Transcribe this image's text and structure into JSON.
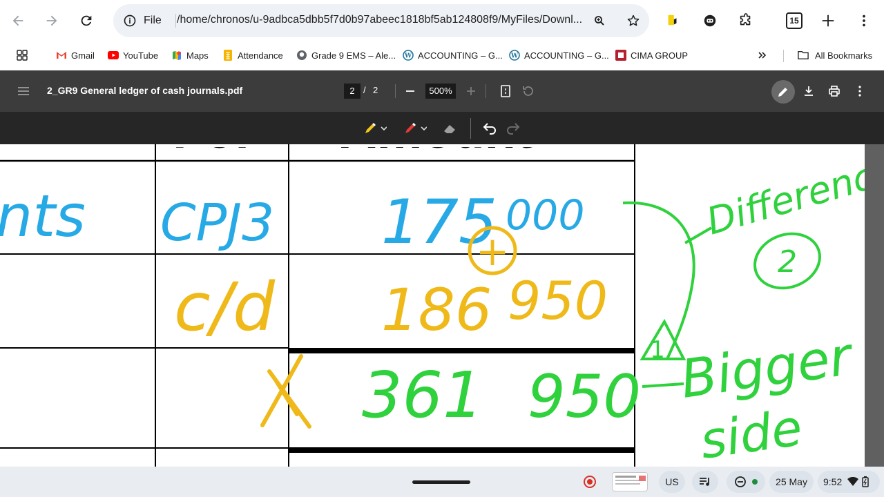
{
  "browser": {
    "site_label": "File",
    "url": "/home/chronos/u-9adbca5dbb5f7d0b97abeec1818bf5ab124808f9/MyFiles/Downl...",
    "tab_count": "15"
  },
  "bookmarks": [
    {
      "label": "Gmail",
      "icon": "gmail-icon"
    },
    {
      "label": "YouTube",
      "icon": "youtube-icon"
    },
    {
      "label": "Maps",
      "icon": "maps-icon"
    },
    {
      "label": "Attendance",
      "icon": "sheets-icon"
    },
    {
      "label": "Grade 9 EMS – Ale...",
      "icon": "github-icon"
    },
    {
      "label": "ACCOUNTING – G...",
      "icon": "wordpress-icon"
    },
    {
      "label": "ACCOUNTING – G...",
      "icon": "wordpress-icon"
    },
    {
      "label": "CIMA GROUP",
      "icon": "cima-icon"
    }
  ],
  "all_bookmarks": "All Bookmarks",
  "pdf": {
    "title": "2_GR9 General ledger of cash journals.pdf",
    "page_current": "2",
    "page_sep": "/",
    "page_total": "2",
    "zoom": "500%"
  },
  "document": {
    "header_fragments": [
      "Fol",
      "Amount"
    ],
    "rows": [
      {
        "details": "nts",
        "fol": "CPJ3",
        "amount_rands": "175",
        "amount_cents": "000"
      },
      {
        "details": "",
        "fol": "c/d",
        "amount_rands": "186",
        "amount_cents": "950"
      },
      {
        "details": "",
        "fol": "",
        "amount_rands": "361",
        "amount_cents": "950"
      }
    ],
    "annotations": {
      "plus_sign": "+",
      "difference": "Difference",
      "difference_marker": "2",
      "bigger_side": [
        "Bigger",
        "side"
      ],
      "bigger_marker": "1"
    }
  },
  "shelf": {
    "keyboard": "US",
    "date": "25 May",
    "time": "9:52"
  },
  "colors": {
    "blue_ink": "#27a9e6",
    "yellow_ink": "#efb91a",
    "green_ink": "#2fd13c",
    "pdf_toolbar": "#3c3c3c",
    "annotation_bar": "#262626"
  }
}
